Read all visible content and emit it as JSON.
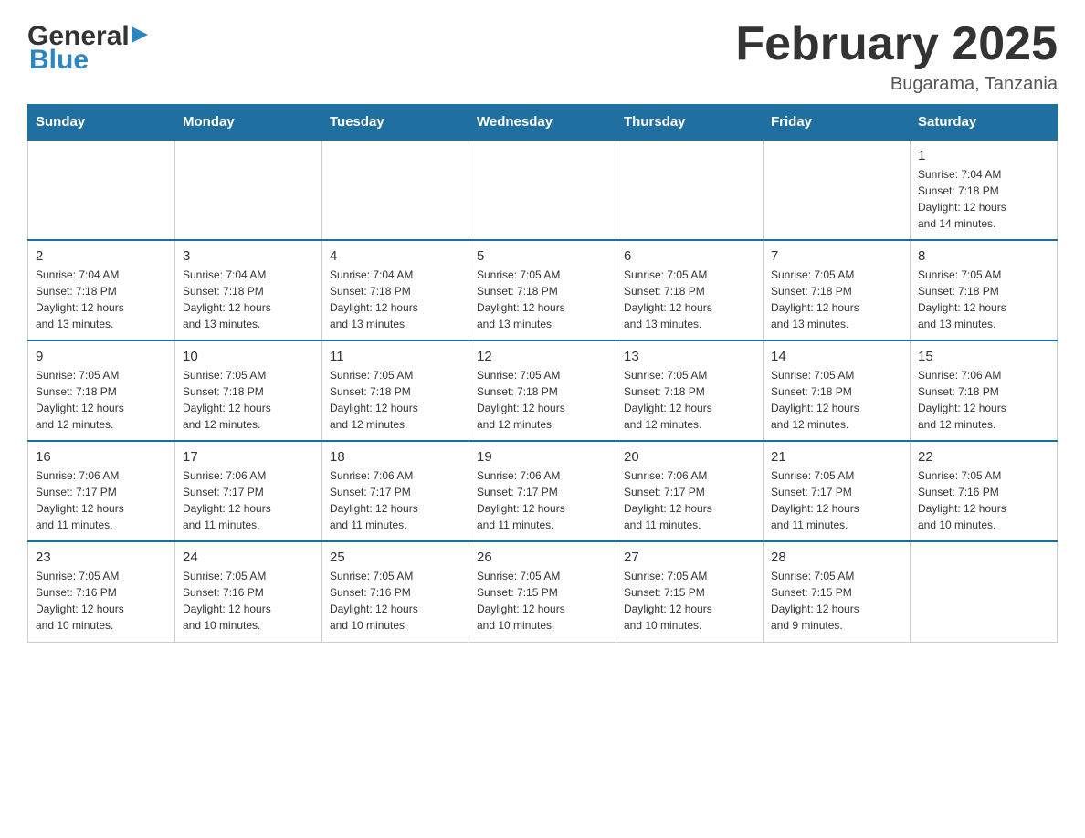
{
  "header": {
    "logo_general": "General",
    "logo_blue": "Blue",
    "month_title": "February 2025",
    "location": "Bugarama, Tanzania"
  },
  "weekdays": [
    "Sunday",
    "Monday",
    "Tuesday",
    "Wednesday",
    "Thursday",
    "Friday",
    "Saturday"
  ],
  "weeks": [
    [
      {
        "day": "",
        "info": ""
      },
      {
        "day": "",
        "info": ""
      },
      {
        "day": "",
        "info": ""
      },
      {
        "day": "",
        "info": ""
      },
      {
        "day": "",
        "info": ""
      },
      {
        "day": "",
        "info": ""
      },
      {
        "day": "1",
        "info": "Sunrise: 7:04 AM\nSunset: 7:18 PM\nDaylight: 12 hours\nand 14 minutes."
      }
    ],
    [
      {
        "day": "2",
        "info": "Sunrise: 7:04 AM\nSunset: 7:18 PM\nDaylight: 12 hours\nand 13 minutes."
      },
      {
        "day": "3",
        "info": "Sunrise: 7:04 AM\nSunset: 7:18 PM\nDaylight: 12 hours\nand 13 minutes."
      },
      {
        "day": "4",
        "info": "Sunrise: 7:04 AM\nSunset: 7:18 PM\nDaylight: 12 hours\nand 13 minutes."
      },
      {
        "day": "5",
        "info": "Sunrise: 7:05 AM\nSunset: 7:18 PM\nDaylight: 12 hours\nand 13 minutes."
      },
      {
        "day": "6",
        "info": "Sunrise: 7:05 AM\nSunset: 7:18 PM\nDaylight: 12 hours\nand 13 minutes."
      },
      {
        "day": "7",
        "info": "Sunrise: 7:05 AM\nSunset: 7:18 PM\nDaylight: 12 hours\nand 13 minutes."
      },
      {
        "day": "8",
        "info": "Sunrise: 7:05 AM\nSunset: 7:18 PM\nDaylight: 12 hours\nand 13 minutes."
      }
    ],
    [
      {
        "day": "9",
        "info": "Sunrise: 7:05 AM\nSunset: 7:18 PM\nDaylight: 12 hours\nand 12 minutes."
      },
      {
        "day": "10",
        "info": "Sunrise: 7:05 AM\nSunset: 7:18 PM\nDaylight: 12 hours\nand 12 minutes."
      },
      {
        "day": "11",
        "info": "Sunrise: 7:05 AM\nSunset: 7:18 PM\nDaylight: 12 hours\nand 12 minutes."
      },
      {
        "day": "12",
        "info": "Sunrise: 7:05 AM\nSunset: 7:18 PM\nDaylight: 12 hours\nand 12 minutes."
      },
      {
        "day": "13",
        "info": "Sunrise: 7:05 AM\nSunset: 7:18 PM\nDaylight: 12 hours\nand 12 minutes."
      },
      {
        "day": "14",
        "info": "Sunrise: 7:05 AM\nSunset: 7:18 PM\nDaylight: 12 hours\nand 12 minutes."
      },
      {
        "day": "15",
        "info": "Sunrise: 7:06 AM\nSunset: 7:18 PM\nDaylight: 12 hours\nand 12 minutes."
      }
    ],
    [
      {
        "day": "16",
        "info": "Sunrise: 7:06 AM\nSunset: 7:17 PM\nDaylight: 12 hours\nand 11 minutes."
      },
      {
        "day": "17",
        "info": "Sunrise: 7:06 AM\nSunset: 7:17 PM\nDaylight: 12 hours\nand 11 minutes."
      },
      {
        "day": "18",
        "info": "Sunrise: 7:06 AM\nSunset: 7:17 PM\nDaylight: 12 hours\nand 11 minutes."
      },
      {
        "day": "19",
        "info": "Sunrise: 7:06 AM\nSunset: 7:17 PM\nDaylight: 12 hours\nand 11 minutes."
      },
      {
        "day": "20",
        "info": "Sunrise: 7:06 AM\nSunset: 7:17 PM\nDaylight: 12 hours\nand 11 minutes."
      },
      {
        "day": "21",
        "info": "Sunrise: 7:05 AM\nSunset: 7:17 PM\nDaylight: 12 hours\nand 11 minutes."
      },
      {
        "day": "22",
        "info": "Sunrise: 7:05 AM\nSunset: 7:16 PM\nDaylight: 12 hours\nand 10 minutes."
      }
    ],
    [
      {
        "day": "23",
        "info": "Sunrise: 7:05 AM\nSunset: 7:16 PM\nDaylight: 12 hours\nand 10 minutes."
      },
      {
        "day": "24",
        "info": "Sunrise: 7:05 AM\nSunset: 7:16 PM\nDaylight: 12 hours\nand 10 minutes."
      },
      {
        "day": "25",
        "info": "Sunrise: 7:05 AM\nSunset: 7:16 PM\nDaylight: 12 hours\nand 10 minutes."
      },
      {
        "day": "26",
        "info": "Sunrise: 7:05 AM\nSunset: 7:15 PM\nDaylight: 12 hours\nand 10 minutes."
      },
      {
        "day": "27",
        "info": "Sunrise: 7:05 AM\nSunset: 7:15 PM\nDaylight: 12 hours\nand 10 minutes."
      },
      {
        "day": "28",
        "info": "Sunrise: 7:05 AM\nSunset: 7:15 PM\nDaylight: 12 hours\nand 9 minutes."
      },
      {
        "day": "",
        "info": ""
      }
    ]
  ]
}
